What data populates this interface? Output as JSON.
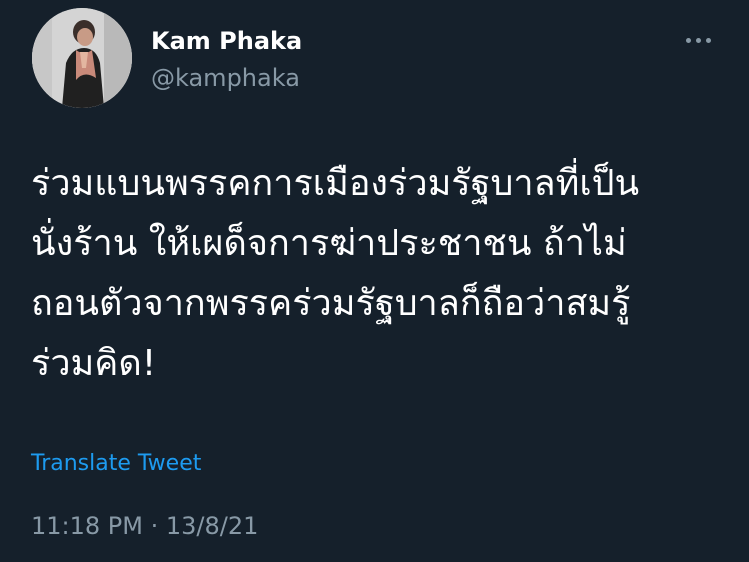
{
  "author": {
    "display_name": "Kam Phaka",
    "handle": "@kamphaka",
    "avatar_icon": "profile-photo"
  },
  "more_icon": "more-horizontal-icon",
  "tweet": {
    "lines": [
      "ร่วมแบนพรรคการเมืองร่วมรัฐบาลที่เป็น",
      "นั่งร้าน ให้เผด็จการฆ่าประชาชน ถ้าไม่",
      "ถอนตัวจากพรรคร่วมรัฐบาลก็ถือว่าสมรู้",
      "ร่วมคิด!"
    ],
    "translate_label": "Translate Tweet",
    "timestamp": "11:18 PM · 13/8/21"
  },
  "colors": {
    "background": "#15202b",
    "primary_text": "#ffffff",
    "secondary_text": "#8899a6",
    "link": "#1d9bf0"
  }
}
